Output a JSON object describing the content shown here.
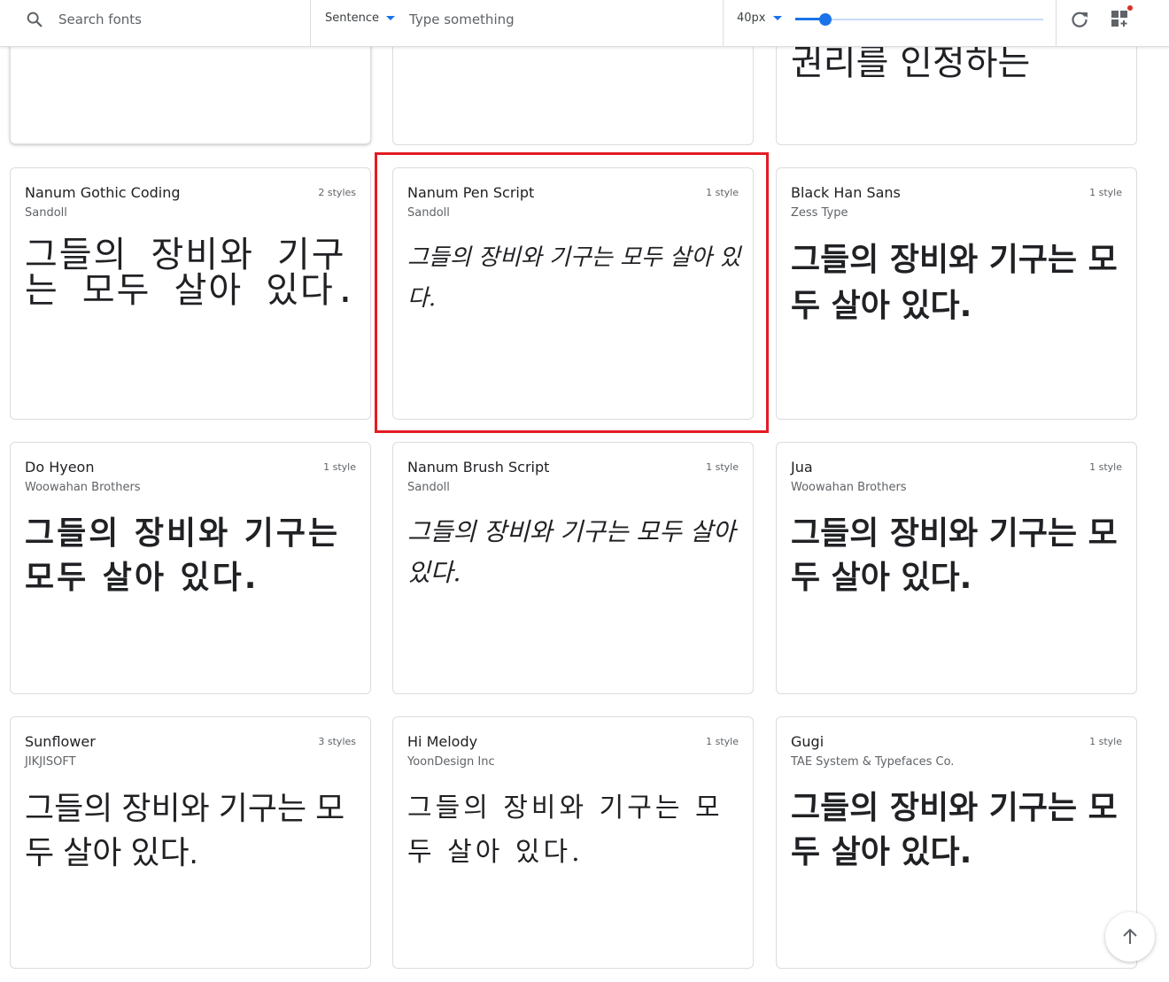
{
  "toolbar": {
    "search_placeholder": "Search fonts",
    "sentence_mode": "Sentence",
    "sentence_placeholder": "Type something",
    "size_label": "40px",
    "size_slider_fraction": 0.12
  },
  "top_row": [
    {
      "sample": ""
    },
    {
      "sample": ""
    },
    {
      "sample": "권리를 인정하는"
    }
  ],
  "cards": [
    {
      "name": "Nanum Gothic Coding",
      "author": "Sandoll",
      "styles": "2 styles",
      "sample": "그들의 장비와 기구는 모두 살아 있다."
    },
    {
      "name": "Nanum Pen Script",
      "author": "Sandoll",
      "styles": "1 style",
      "sample": "그들의 장비와 기구는 모두 살아 있다."
    },
    {
      "name": "Black Han Sans",
      "author": "Zess Type",
      "styles": "1 style",
      "sample": "그들의 장비와 기구는 모두 살아 있다."
    },
    {
      "name": "Do Hyeon",
      "author": "Woowahan Brothers",
      "styles": "1 style",
      "sample": "그들의 장비와 기구는 모두 살아 있다."
    },
    {
      "name": "Nanum Brush Script",
      "author": "Sandoll",
      "styles": "1 style",
      "sample": "그들의 장비와 기구는 모두 살아 있다."
    },
    {
      "name": "Jua",
      "author": "Woowahan Brothers",
      "styles": "1 style",
      "sample": "그들의 장비와 기구는 모두 살아 있다."
    },
    {
      "name": "Sunflower",
      "author": "JIKJISOFT",
      "styles": "3 styles",
      "sample": "그들의 장비와 기구는 모두 살아 있다."
    },
    {
      "name": "Hi Melody",
      "author": "YoonDesign Inc",
      "styles": "1 style",
      "sample": "그들의 장비와 기구는 모두 살아 있다."
    },
    {
      "name": "Gugi",
      "author": "TAE System & Typefaces Co.",
      "styles": "1 style",
      "sample": "그들의 장비와 기구는 모두 살아 있다."
    }
  ],
  "icons": {
    "search": "search-icon",
    "reset": "refresh-icon",
    "collection": "collection-grid-icon",
    "back_to_top": "arrow-up-icon"
  },
  "colors": {
    "accent": "#1a73e8",
    "highlight": "#e31b23",
    "badge": "#d93025"
  }
}
